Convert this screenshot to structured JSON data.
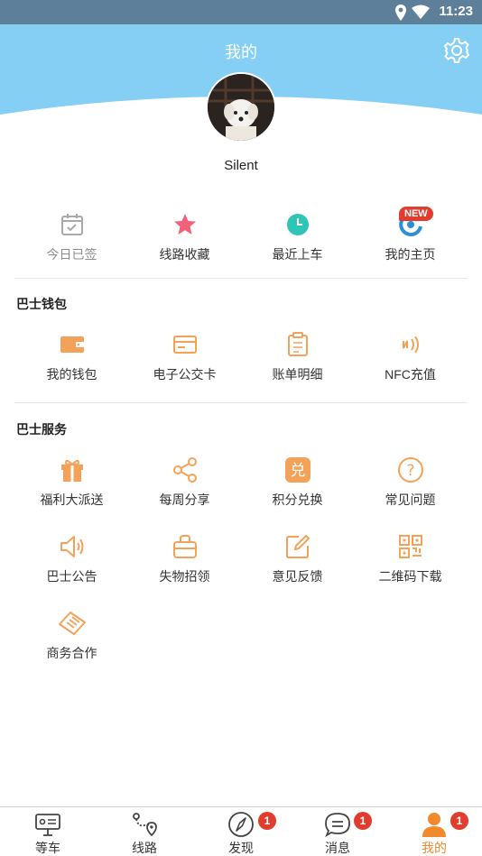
{
  "status_bar": {
    "time": "11:23"
  },
  "header": {
    "title": "我的"
  },
  "profile": {
    "username": "Silent"
  },
  "quick_actions": [
    {
      "label": "今日已签",
      "icon": "calendar-check-icon"
    },
    {
      "label": "线路收藏",
      "icon": "star-icon"
    },
    {
      "label": "最近上车",
      "icon": "clock-icon"
    },
    {
      "label": "我的主页",
      "icon": "profile-home-icon",
      "badge": "NEW"
    }
  ],
  "wallet": {
    "title": "巴士钱包",
    "items": [
      {
        "label": "我的钱包",
        "icon": "wallet-icon"
      },
      {
        "label": "电子公交卡",
        "icon": "bus-card-icon"
      },
      {
        "label": "账单明细",
        "icon": "bill-icon"
      },
      {
        "label": "NFC充值",
        "icon": "nfc-icon"
      }
    ]
  },
  "services": {
    "title": "巴士服务",
    "items": [
      {
        "label": "福利大派送",
        "icon": "gift-icon"
      },
      {
        "label": "每周分享",
        "icon": "share-icon"
      },
      {
        "label": "积分兑换",
        "icon": "points-exchange-icon",
        "glyph": "兑"
      },
      {
        "label": "常见问题",
        "icon": "question-icon",
        "glyph": "?"
      },
      {
        "label": "巴士公告",
        "icon": "speaker-icon"
      },
      {
        "label": "失物招领",
        "icon": "bag-icon"
      },
      {
        "label": "意见反馈",
        "icon": "feedback-edit-icon"
      },
      {
        "label": "二维码下载",
        "icon": "qr-code-icon"
      },
      {
        "label": "商务合作",
        "icon": "handshake-icon"
      }
    ]
  },
  "tabs": [
    {
      "label": "等车",
      "icon": "bus-stop-icon",
      "badge": ""
    },
    {
      "label": "线路",
      "icon": "route-icon",
      "badge": ""
    },
    {
      "label": "发现",
      "icon": "compass-icon",
      "badge": "1"
    },
    {
      "label": "消息",
      "icon": "message-icon",
      "badge": "1"
    },
    {
      "label": "我的",
      "icon": "user-icon",
      "badge": "1",
      "active": true
    }
  ],
  "colors": {
    "header_blue": "#86cff4",
    "status_bar": "#5d7f9a",
    "accent_orange": "#f4a25a",
    "active_tab": "#f08a2c",
    "badge_red": "#e03d2e",
    "star_pink": "#f2607a",
    "clock_teal": "#2ec4b6"
  }
}
